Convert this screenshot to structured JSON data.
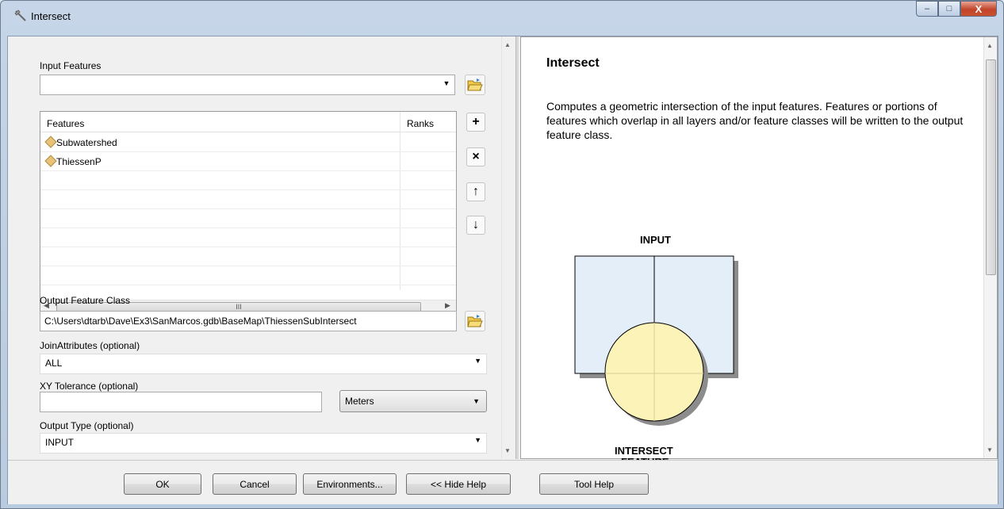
{
  "window": {
    "title": "Intersect",
    "caption_minimize": "–",
    "caption_maximize": "□",
    "caption_close": "X"
  },
  "form": {
    "input_features_label": "Input Features",
    "input_features_value": "",
    "grid": {
      "header_features": "Features",
      "header_ranks": "Ranks",
      "rows": [
        {
          "name": "Subwatershed",
          "rank": ""
        },
        {
          "name": "ThiessenP",
          "rank": ""
        }
      ],
      "scroll_mark": "III"
    },
    "output_label": "Output Feature Class",
    "output_value": "C:\\Users\\dtarb\\Dave\\Ex3\\SanMarcos.gdb\\BaseMap\\ThiessenSubIntersect",
    "join_label": "JoinAttributes (optional)",
    "join_value": "ALL",
    "xy_label": "XY Tolerance (optional)",
    "xy_value": "",
    "xy_units": "Meters",
    "output_type_label": "Output Type (optional)",
    "output_type_value": "INPUT"
  },
  "side_buttons": {
    "add": "+",
    "remove": "×",
    "up": "↑",
    "down": "↓"
  },
  "footer": {
    "ok": "OK",
    "cancel": "Cancel",
    "environments": "Environments...",
    "hide_help": "<< Hide Help",
    "tool_help": "Tool Help"
  },
  "help": {
    "title": "Intersect",
    "body": "Computes a geometric intersection of the input features. Features or portions of features which overlap in all layers and/or feature classes will be written to the output feature class.",
    "diagram_input_label": "INPUT",
    "diagram_intersect_line1": "INTERSECT",
    "diagram_intersect_line2": "FEATURE"
  },
  "colors": {
    "input_fill": "#e3eef9",
    "circle_fill": "#fbf3b8",
    "layer_icon": "#e6c27a"
  },
  "icons": [
    "hammer-icon",
    "folder-open-icon",
    "plus-icon",
    "close-icon",
    "arrow-up-icon",
    "arrow-down-icon",
    "polygon-layer-icon",
    "chevron-down-icon"
  ]
}
